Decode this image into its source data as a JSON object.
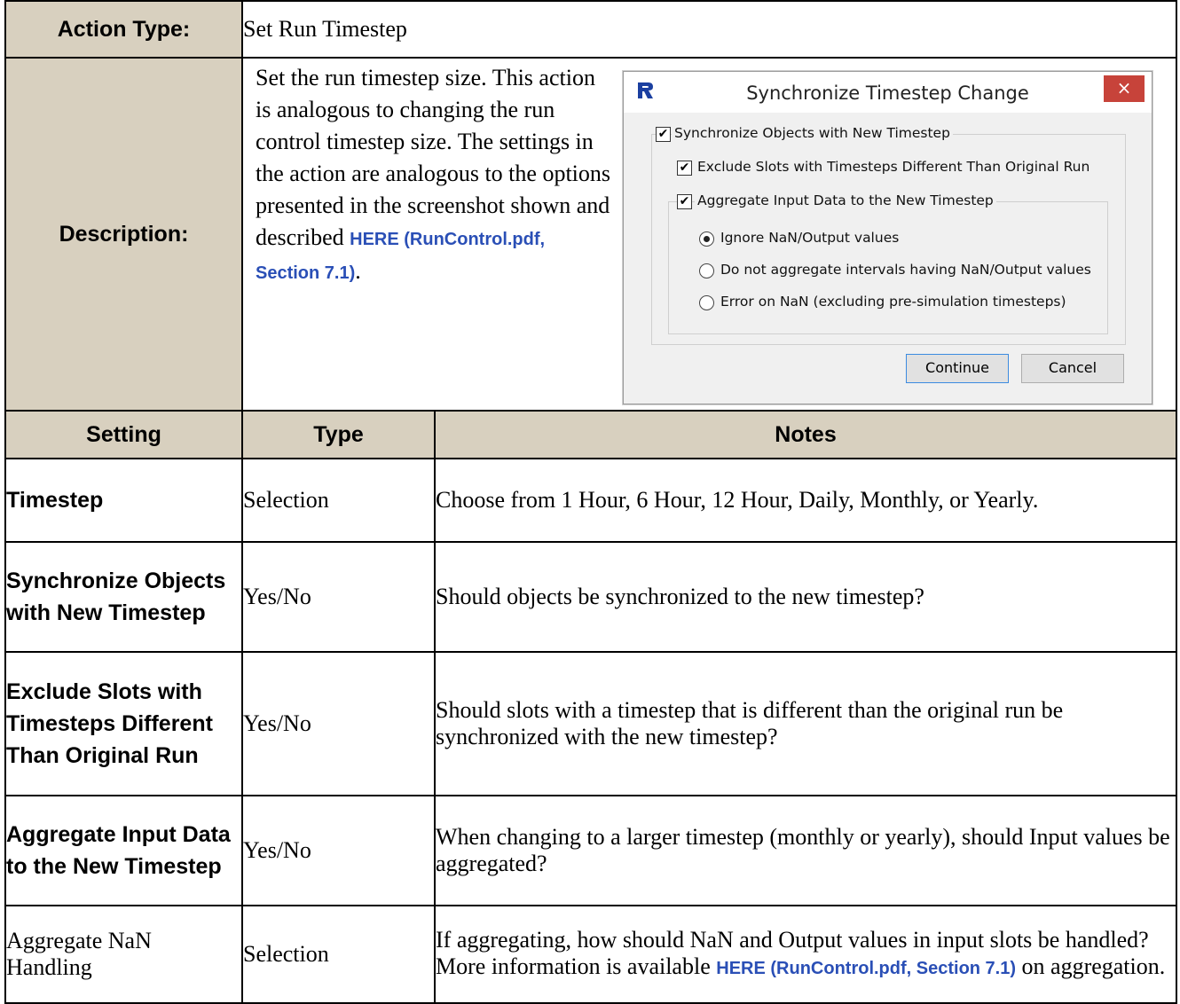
{
  "action_type_label": "Action Type:",
  "action_type_value": "Set Run Timestep",
  "description_label": "Description:",
  "description_text": "Set the run timestep size. This action is analogous to changing the run control timestep size. The settings in the action are analogous to the options presented in the screenshot shown and described",
  "description_link": "HERE (RunControl.pdf, Section 7.1)",
  "description_end": ".",
  "dialog": {
    "title": "Synchronize Timestep Change",
    "close_glyph": "×",
    "sync_label": "Synchronize Objects with New Timestep",
    "sync_checked": true,
    "exclude_label": "Exclude Slots with Timesteps Different Than Original Run",
    "exclude_checked": true,
    "aggregate_label": "Aggregate Input Data to the New Timestep",
    "aggregate_checked": true,
    "radio_options": [
      "Ignore NaN/Output values",
      "Do not aggregate intervals having NaN/Output values",
      "Error on NaN  (excluding pre-simulation timesteps)"
    ],
    "radio_selected": 0,
    "continue_button": "Continue",
    "cancel_button": "Cancel",
    "check_glyph": "✔"
  },
  "table_headers": [
    "Setting",
    "Type",
    "Notes"
  ],
  "rows": [
    {
      "setting": "Timestep",
      "type": "Selection",
      "notes": "Choose from 1 Hour, 6 Hour, 12 Hour, Daily, Monthly, or Yearly."
    },
    {
      "setting": "Synchronize Objects with New Timestep",
      "type": "Yes/No",
      "notes": "Should objects be synchronized to the new timestep?"
    },
    {
      "setting": "Exclude Slots with Timesteps Different Than Original Run",
      "type": "Yes/No",
      "notes": "Should slots with a timestep that is different than the original run be synchronized with the new timestep?"
    },
    {
      "setting": "Aggregate Input Data to the New Timestep",
      "type": "Yes/No",
      "notes": "When changing to a larger timestep (monthly or yearly), should Input values be aggregated?"
    },
    {
      "setting": "Aggregate NaN Handling",
      "type": "Selection",
      "notes": "If aggregating, how should NaN and Output values in input slots be handled? More information is available",
      "notes_link": "HERE (RunControl.pdf, Section 7.1)",
      "notes_end": " on aggregation."
    }
  ],
  "colors": {
    "header_bg": "#d8d0bf",
    "link": "#2a4fb6",
    "close_bg": "#c7433a"
  }
}
